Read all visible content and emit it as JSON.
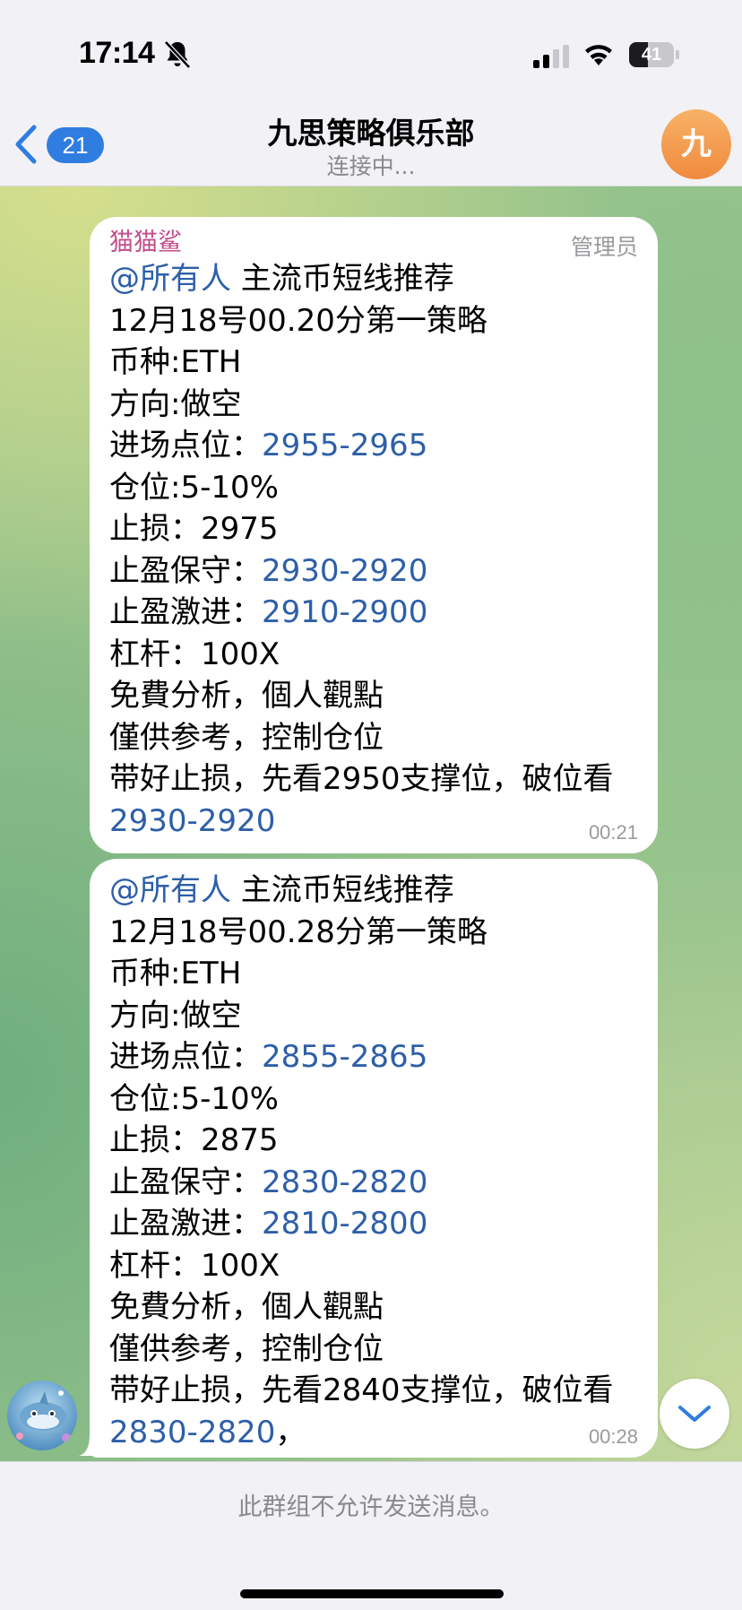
{
  "status": {
    "time": "17:14",
    "battery_label": "41",
    "battery_level": 0.41,
    "icons": [
      "bell-off-icon",
      "cellular-signal-icon",
      "wifi-icon",
      "battery-icon"
    ]
  },
  "nav": {
    "back_icon": "chevron-left-icon",
    "unread_count": "21",
    "title": "九思策略俱乐部",
    "subtitle": "连接中...",
    "avatar_letter": "九",
    "avatar_colors": [
      "#f7b267",
      "#f08a3e"
    ]
  },
  "messages": [
    {
      "sender": "猫猫鲨",
      "role": "管理员",
      "lines": [
        {
          "mention": "@所有人",
          "text": " 主流币短线推荐"
        },
        {
          "text": "12月18号00.20分第一策略"
        },
        {
          "text": "币种:ETH"
        },
        {
          "text": "方向:做空"
        },
        {
          "text": "进场点位：",
          "link": "2955-2965"
        },
        {
          "text": "仓位:5-10%"
        },
        {
          "text": "止损：2975"
        },
        {
          "text": "止盈保守：",
          "link": "2930-2920"
        },
        {
          "text": "止盈激进：",
          "link": "2910-2900"
        },
        {
          "text": "杠杆：100X"
        },
        {
          "text": "免費分析，個人觀點"
        },
        {
          "text": "僅供参考，控制仓位"
        },
        {
          "text": "带好止损，先看2950支撑位，破位看"
        },
        {
          "text": " ",
          "link": "2930-2920"
        }
      ],
      "time": "00:21"
    },
    {
      "lines": [
        {
          "mention": "@所有人",
          "text": " 主流币短线推荐"
        },
        {
          "text": "12月18号00.28分第一策略"
        },
        {
          "text": "币种:ETH"
        },
        {
          "text": "方向:做空"
        },
        {
          "text": "进场点位：",
          "link": "2855-2865"
        },
        {
          "text": "仓位:5-10%"
        },
        {
          "text": "止损：2875"
        },
        {
          "text": "止盈保守：",
          "link": "2830-2820"
        },
        {
          "text": "止盈激进：",
          "link": "2810-2800"
        },
        {
          "text": "杠杆：100X"
        },
        {
          "text": "免費分析，個人觀點"
        },
        {
          "text": "僅供参考，控制仓位"
        },
        {
          "text": "带好止损，先看2840支撑位，破位看"
        },
        {
          "text": " ",
          "link": "2830-2820",
          "after": "，"
        }
      ],
      "time": "00:28"
    }
  ],
  "sender_avatar_icon": "shark-avatar-icon",
  "scroll_button_icon": "chevron-down-icon",
  "footer": {
    "notice": "此群组不允许发送消息。"
  },
  "colors": {
    "accent": "#2f7de1",
    "link": "#2d5fa8",
    "sender_name": "#c24c8a"
  }
}
